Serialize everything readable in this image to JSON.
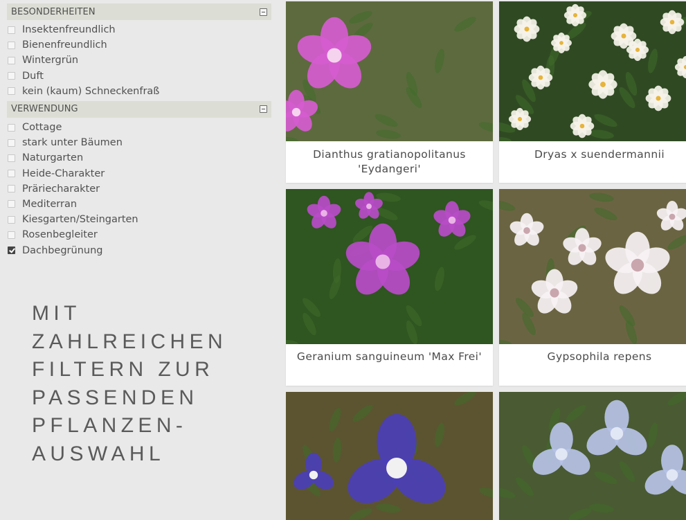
{
  "filters": {
    "sections": [
      {
        "title": "BESONDERHEITEN",
        "options": [
          {
            "label": "Insektenfreundlich",
            "checked": false
          },
          {
            "label": "Bienenfreundlich",
            "checked": false
          },
          {
            "label": "Wintergrün",
            "checked": false
          },
          {
            "label": "Duft",
            "checked": false
          },
          {
            "label": "kein (kaum) Schneckenfraß",
            "checked": false
          }
        ]
      },
      {
        "title": "VERWENDUNG",
        "options": [
          {
            "label": "Cottage",
            "checked": false
          },
          {
            "label": "stark unter Bäumen",
            "checked": false
          },
          {
            "label": "Naturgarten",
            "checked": false
          },
          {
            "label": "Heide-Charakter",
            "checked": false
          },
          {
            "label": "Präriecharakter",
            "checked": false
          },
          {
            "label": "Mediterran",
            "checked": false
          },
          {
            "label": "Kiesgarten/Steingarten",
            "checked": false
          },
          {
            "label": "Rosenbegleiter",
            "checked": false
          },
          {
            "label": "Dachbegrünung",
            "checked": true
          }
        ]
      }
    ]
  },
  "tagline": [
    "MIT",
    "ZAHLREICHEN",
    "FILTERN ZUR",
    "PASSENDEN",
    "PFLANZEN-",
    "AUSWAHL"
  ],
  "plants": [
    {
      "name": "Dianthus gratianopolitanus 'Eydangeri'",
      "icon": "pink-dianthus-flower-photo",
      "colors": {
        "bg": "#5d6a3e",
        "petal": "#d65ccf",
        "center": "#f5d3ee"
      }
    },
    {
      "name": "Dryas x suendermannii",
      "icon": "white-dryas-flowers-photo",
      "colors": {
        "bg": "#2f4a22",
        "petal": "#f6f3ea",
        "center": "#e6b43c"
      }
    },
    {
      "name": "Geranium sanguineum 'Max Frei'",
      "icon": "magenta-geranium-flower-photo",
      "colors": {
        "bg": "#2f5520",
        "petal": "#b94cc8",
        "center": "#e9b3e6"
      }
    },
    {
      "name": "Gypsophila repens",
      "icon": "white-gypsophila-flowers-photo",
      "colors": {
        "bg": "#6b6442",
        "petal": "#f7f2f4",
        "center": "#c9a6ad"
      }
    },
    {
      "name": "",
      "icon": "purple-iris-flower-photo",
      "colors": {
        "bg": "#5c5430",
        "petal": "#4b3fb8",
        "center": "#f1f1f1"
      }
    },
    {
      "name": "",
      "icon": "pale-blue-iris-flowers-photo",
      "colors": {
        "bg": "#4a5a32",
        "petal": "#b6c2e6",
        "center": "#e2e7f5"
      }
    }
  ]
}
